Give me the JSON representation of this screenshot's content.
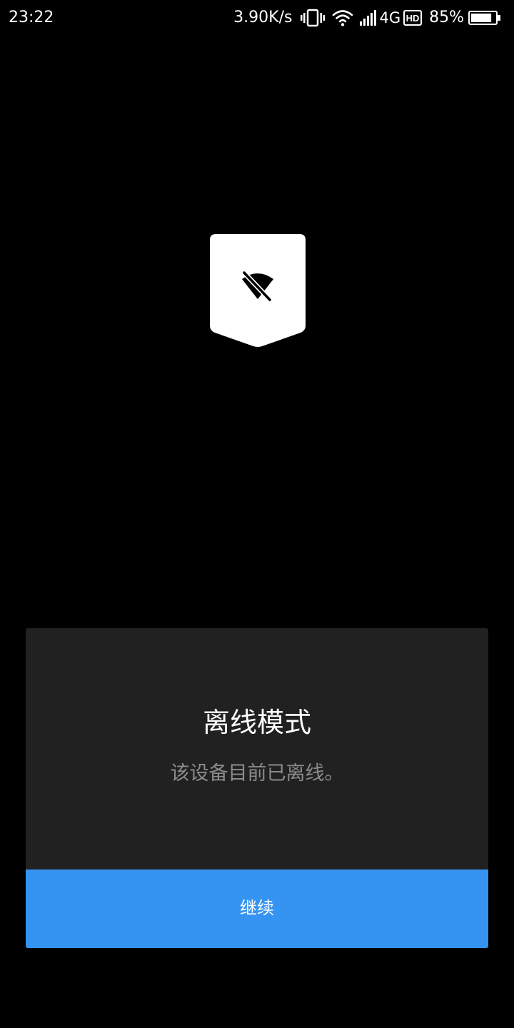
{
  "status_bar": {
    "time": "23:22",
    "net_speed": "3.90K/s",
    "network_type": "4G",
    "hd_badge": "HD",
    "battery_percent": "85%",
    "battery_level": 0.85,
    "icons": [
      "vibrate-icon",
      "wifi-icon",
      "signal-icon",
      "hd-icon",
      "battery-icon"
    ]
  },
  "offline_badge": {
    "icon": "wifi-off-icon"
  },
  "dialog": {
    "title": "离线模式",
    "message": "该设备目前已离线。",
    "continue_label": "继续"
  },
  "colors": {
    "background": "#000000",
    "dialog_background": "#212121",
    "accent": "#3593f2",
    "message_text": "#8c8c8c"
  }
}
